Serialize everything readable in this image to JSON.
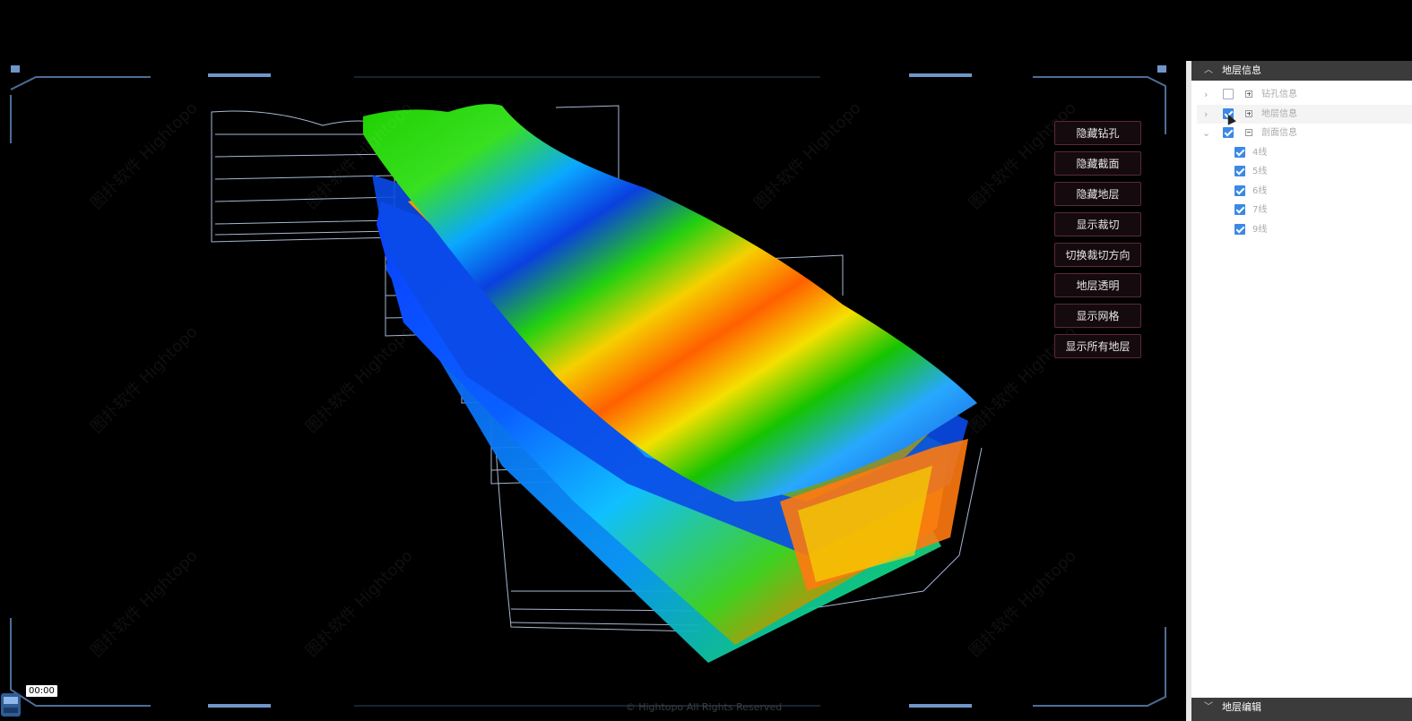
{
  "viewport": {
    "buttons": [
      {
        "label": "隐藏钻孔"
      },
      {
        "label": "隐藏截面"
      },
      {
        "label": "隐藏地层"
      },
      {
        "label": "显示裁切"
      },
      {
        "label": "切换裁切方向"
      },
      {
        "label": "地层透明"
      },
      {
        "label": "显示网格"
      },
      {
        "label": "显示所有地层"
      }
    ],
    "copyright": "© Hightopo All Rights Reserved",
    "watermark_cn": "图扑软件",
    "watermark_en": "Hightopo"
  },
  "player": {
    "time": "00:00"
  },
  "panel": {
    "header": "地层信息",
    "footer": "地层编辑",
    "tree": [
      {
        "label": "钻孔信息",
        "checked": false,
        "expanded": false
      },
      {
        "label": "地层信息",
        "checked": true,
        "expanded": false
      },
      {
        "label": "剖面信息",
        "checked": true,
        "expanded": true,
        "children": [
          {
            "label": "4线",
            "checked": true
          },
          {
            "label": "5线",
            "checked": true
          },
          {
            "label": "6线",
            "checked": true
          },
          {
            "label": "7线",
            "checked": true
          },
          {
            "label": "9线",
            "checked": true
          }
        ]
      }
    ]
  },
  "colors": {
    "accent": "#3a89e6",
    "button_border": "#5a2a34",
    "frame_line": "#4d6d96",
    "panel_header": "#3b3b3b"
  }
}
